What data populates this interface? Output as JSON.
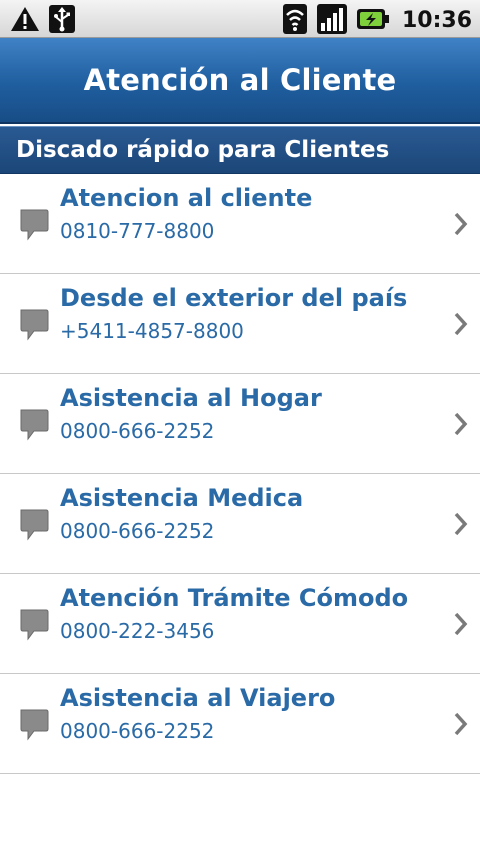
{
  "status_bar": {
    "time": "10:36",
    "icons": [
      "warning-icon",
      "usb-icon",
      "wifi-icon",
      "signal-icon",
      "battery-charging-icon"
    ]
  },
  "header": {
    "title": "Atención al Cliente"
  },
  "section": {
    "title": "Discado rápido para Clientes"
  },
  "contacts": [
    {
      "name": "Atencion al cliente",
      "phone": "0810-777-8800"
    },
    {
      "name": "Desde el exterior del país",
      "phone": "+5411-4857-8800"
    },
    {
      "name": "Asistencia al Hogar",
      "phone": "0800-666-2252"
    },
    {
      "name": "Asistencia Medica",
      "phone": "0800-666-2252"
    },
    {
      "name": "Atención Trámite Cómodo",
      "phone": "0800-222-3456"
    },
    {
      "name": "Asistencia al Viajero",
      "phone": "0800-666-2252"
    }
  ],
  "colors": {
    "header": "#1f5e9f",
    "link_text": "#2a6aa6",
    "divider": "#c8c8c8"
  }
}
